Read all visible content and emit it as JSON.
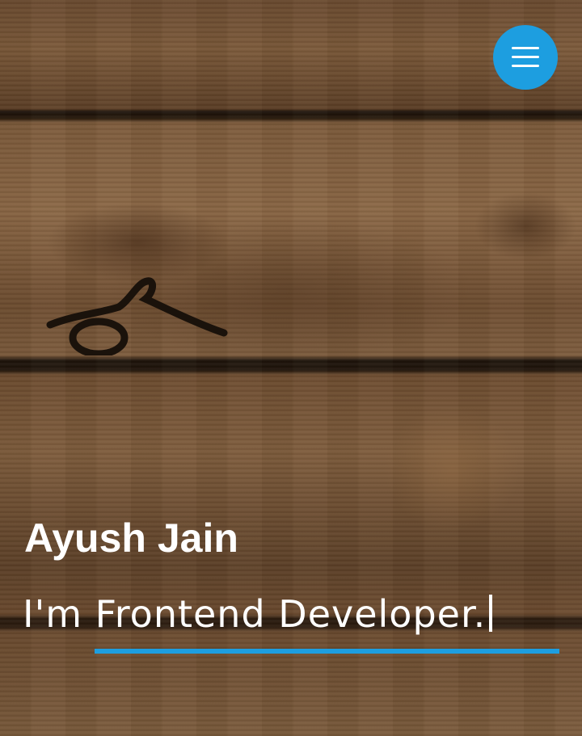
{
  "hero": {
    "name": "Ayush Jain",
    "tagline_prefix": "I'm",
    "tagline_role": "Frontend Developer.",
    "accent_color": "#1d9ee0",
    "background": "wooden-planks-texture"
  },
  "nav": {
    "menu_icon": "hamburger-menu-icon"
  }
}
